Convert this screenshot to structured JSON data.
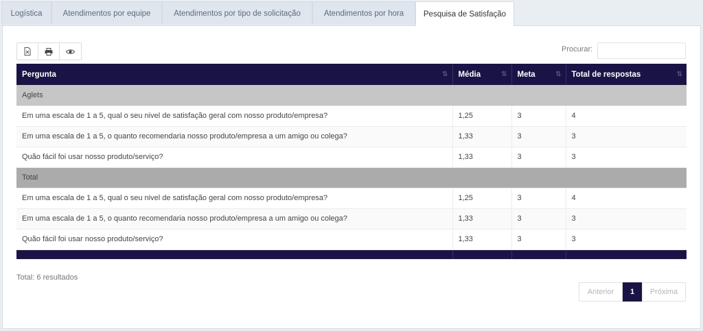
{
  "tabs": [
    {
      "label": "Logística"
    },
    {
      "label": "Atendimentos por equipe"
    },
    {
      "label": "Atendimentos por tipo de solicitação"
    },
    {
      "label": "Atendimentos por hora"
    },
    {
      "label": "Pesquisa de Satisfação",
      "active": true
    }
  ],
  "toolbar": {
    "icons": [
      "excel-export-icon",
      "print-icon",
      "eye-icon"
    ]
  },
  "search": {
    "label": "Procurar:",
    "value": ""
  },
  "table": {
    "headers": [
      "Pergunta",
      "Média",
      "Meta",
      "Total de respostas"
    ],
    "groups": [
      {
        "name": "Aglets",
        "rows": [
          [
            "Em uma escala de 1 a 5, qual o seu nivel de satisfação geral com nosso produto/empresa?",
            "1,25",
            "3",
            "4"
          ],
          [
            "Em uma escala de 1 a 5, o quanto recomendaria nosso produto/empresa a um amigo ou colega?",
            "1,33",
            "3",
            "3"
          ],
          [
            "Quão fácil foi usar nosso produto/serviço?",
            "1,33",
            "3",
            "3"
          ]
        ]
      },
      {
        "name": "Total",
        "rows": [
          [
            "Em uma escala de 1 a 5, qual o seu nivel de satisfação geral com nosso produto/empresa?",
            "1,25",
            "3",
            "4"
          ],
          [
            "Em uma escala de 1 a 5, o quanto recomendaria nosso produto/empresa a um amigo ou colega?",
            "1,33",
            "3",
            "3"
          ],
          [
            "Quão fácil foi usar nosso produto/serviço?",
            "1,33",
            "3",
            "3"
          ]
        ]
      }
    ]
  },
  "footer": {
    "result_text": "Total: 6 resultados"
  },
  "pagination": {
    "prev": "Anterior",
    "current": "1",
    "next": "Próxima"
  },
  "colors": {
    "header_bg": "#1a1446",
    "group_bg": "#c6c6c6",
    "total_bg": "#ababab"
  }
}
